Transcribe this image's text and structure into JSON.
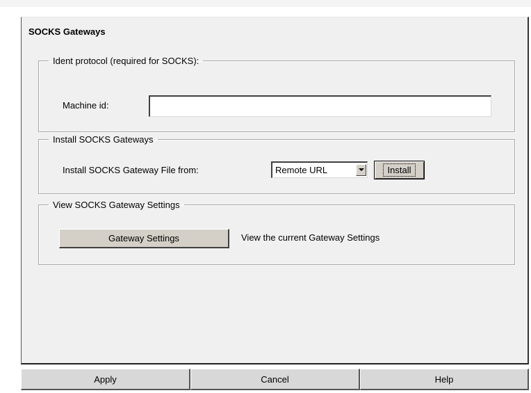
{
  "panel": {
    "title": "SOCKS Gateways"
  },
  "ident_group": {
    "legend": "Ident protocol (required for SOCKS):",
    "machine_id_label": "Machine id:",
    "machine_id_value": ""
  },
  "install_group": {
    "legend": "Install SOCKS Gateways",
    "file_from_label": "Install SOCKS Gateway File from:",
    "source_selected": "Remote URL",
    "install_button": "Install"
  },
  "view_group": {
    "legend": "View SOCKS Gateway Settings",
    "settings_button": "Gateway Settings",
    "settings_description": "View the current Gateway Settings"
  },
  "footer": {
    "apply": "Apply",
    "cancel": "Cancel",
    "help": "Help"
  },
  "icons": {
    "dropdown": "chevron-down-icon"
  }
}
